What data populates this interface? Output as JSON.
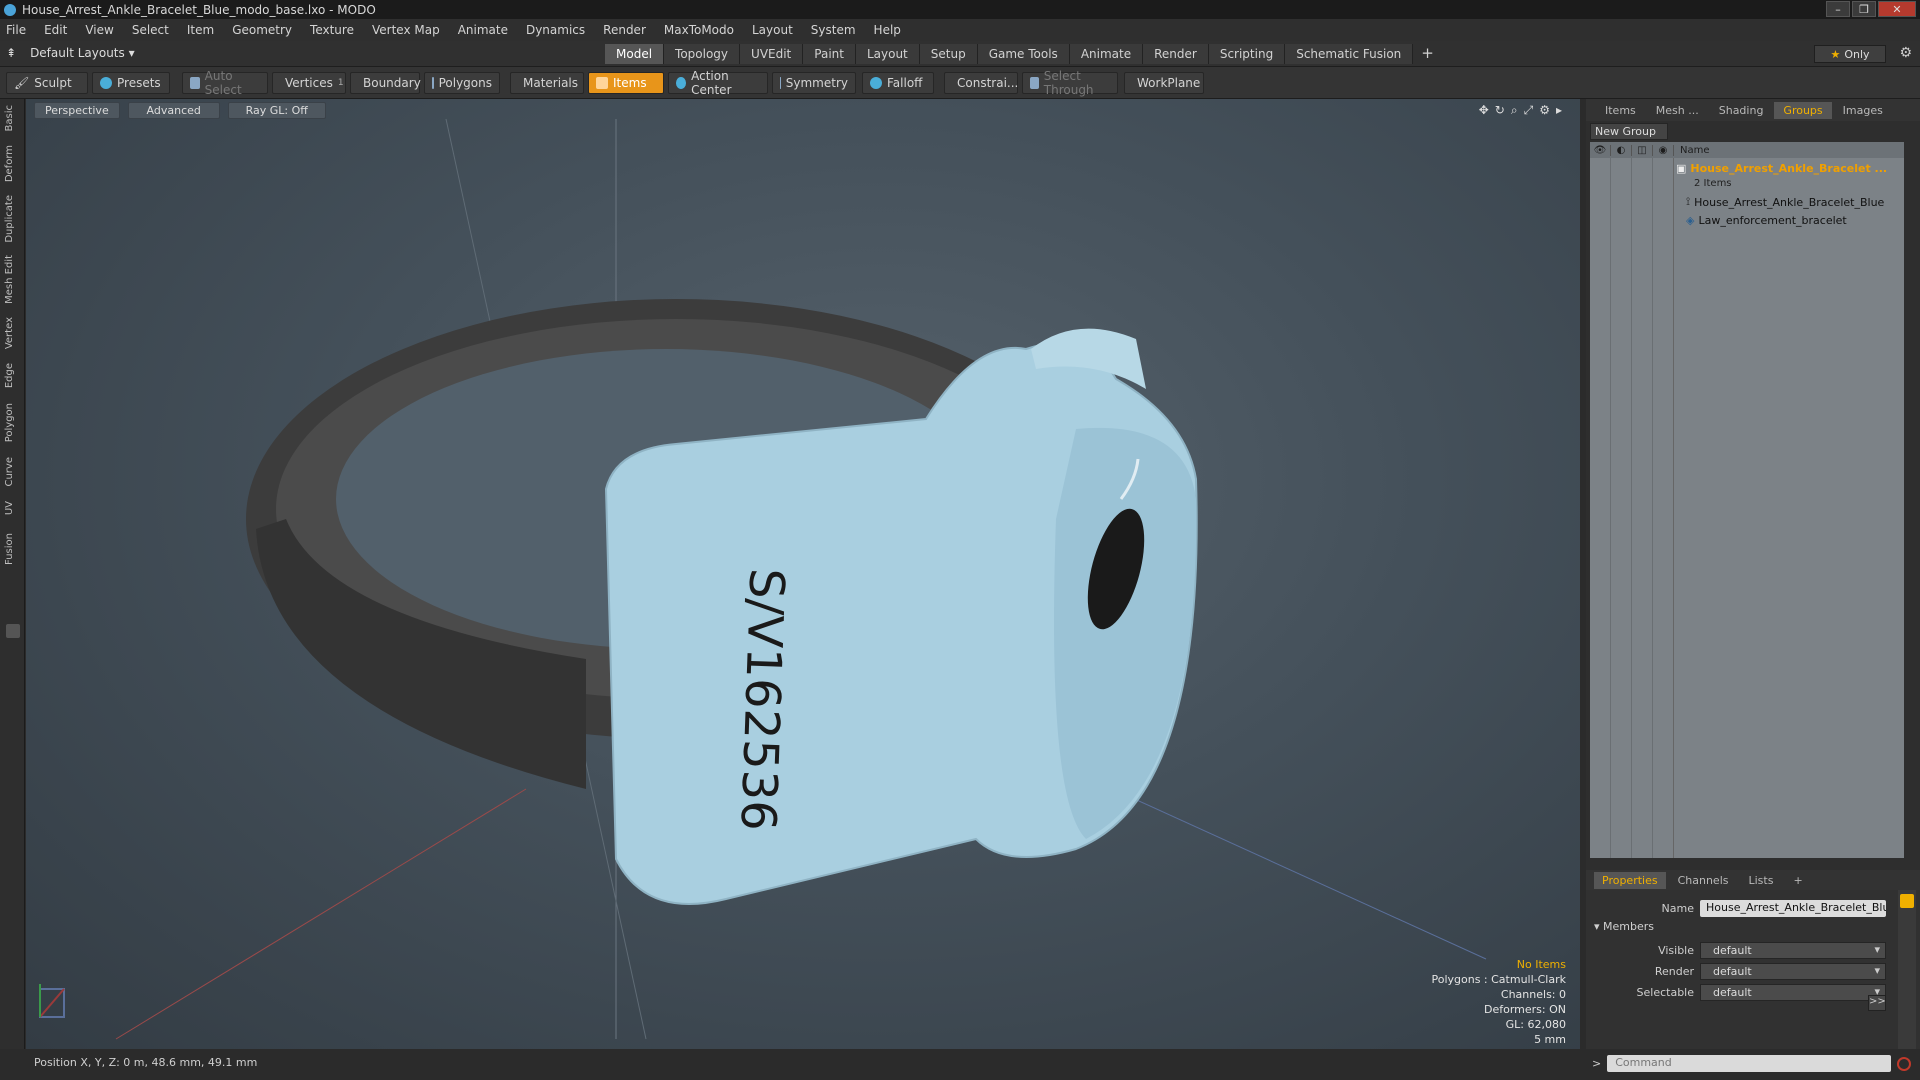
{
  "window": {
    "title": "House_Arrest_Ankle_Bracelet_Blue_modo_base.lxo - MODO",
    "btn_min": "–",
    "btn_max": "❐",
    "btn_close": "✕"
  },
  "menu": [
    "File",
    "Edit",
    "View",
    "Select",
    "Item",
    "Geometry",
    "Texture",
    "Vertex Map",
    "Animate",
    "Dynamics",
    "Render",
    "MaxToModo",
    "Layout",
    "System",
    "Help"
  ],
  "layout": {
    "default_layouts": "Default Layouts ▾",
    "tabs": [
      "Model",
      "Topology",
      "UVEdit",
      "Paint",
      "Layout",
      "Setup",
      "Game Tools",
      "Animate",
      "Render",
      "Scripting",
      "Schematic Fusion"
    ],
    "active_tab": "Model",
    "plus": "+",
    "only": "Only"
  },
  "toolbar": {
    "sculpt": "Sculpt",
    "presets": "Presets",
    "auto_select": "Auto Select",
    "vertices": "Vertices",
    "vertices_count": "1",
    "boundary": "Boundary",
    "polygons": "Polygons",
    "materials": "Materials",
    "items": "Items",
    "action_center": "Action Center",
    "symmetry": "Symmetry",
    "falloff": "Falloff",
    "constraints": "Constrai...",
    "select_through": "Select Through",
    "workplane": "WorkPlane"
  },
  "left_rail": [
    "Basic",
    "Deform",
    "Duplicate",
    "Mesh Edit",
    "Vertex",
    "Edge",
    "Polygon",
    "Curve",
    "UV",
    "Fusion"
  ],
  "viewport": {
    "perspective": "Perspective",
    "advanced": "Advanced",
    "raygl": "Ray GL: Off",
    "serial": "S/V162536",
    "info": {
      "no_items": "No Items",
      "polygons": "Polygons : Catmull-Clark",
      "channels": "Channels: 0",
      "deformers": "Deformers: ON",
      "gl": "GL: 62,080",
      "scale": "5 mm"
    },
    "colors": {
      "body": "#a9cfe0",
      "strap": "#3c3c3c",
      "accent": "#f0b000"
    }
  },
  "right_panel": {
    "tabs": [
      "Items",
      "Mesh ...",
      "Shading",
      "Groups",
      "Images"
    ],
    "active_tab": "Groups",
    "new_group": "New Group",
    "name_col": "Name",
    "tree": {
      "parent": "House_Arrest_Ankle_Bracelet ...",
      "count": "2 Items",
      "children": [
        "House_Arrest_Ankle_Bracelet_Blue",
        "Law_enforcement_bracelet"
      ]
    }
  },
  "properties": {
    "tabs": [
      "Properties",
      "Channels",
      "Lists"
    ],
    "plus": "+",
    "name_label": "Name",
    "name_value": "House_Arrest_Ankle_Bracelet_Blue (",
    "members": "Members",
    "visible_label": "Visible",
    "visible_value": "default",
    "render_label": "Render",
    "render_value": "default",
    "selectable_label": "Selectable",
    "selectable_value": "default",
    "more": ">>"
  },
  "status": {
    "position": "Position X, Y, Z:  0 m, 48.6 mm, 49.1 mm"
  },
  "command": {
    "placeholder": "Command",
    "prompt": ">"
  }
}
